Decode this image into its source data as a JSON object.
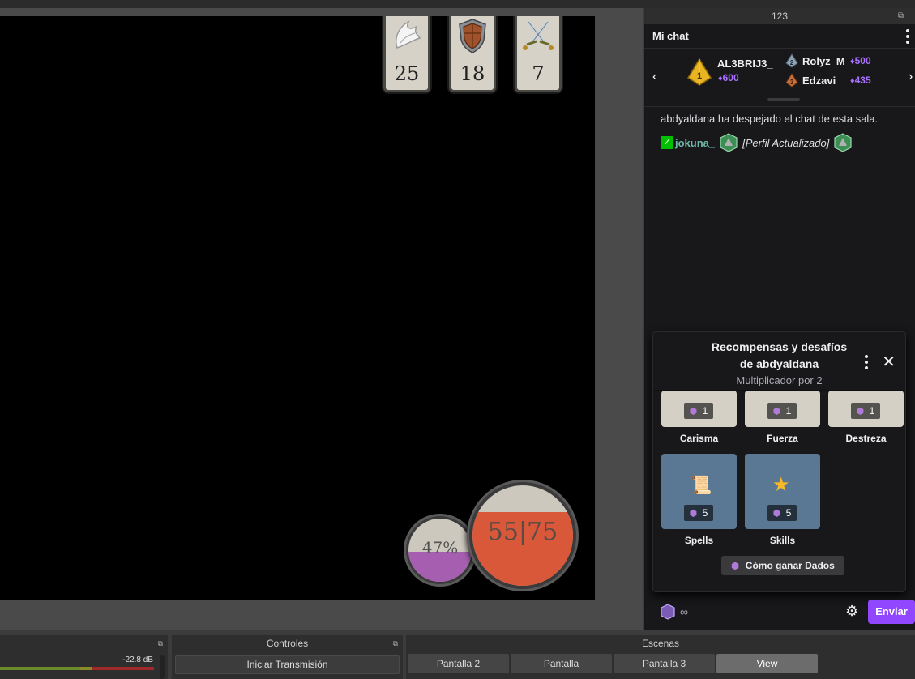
{
  "window": {
    "dock_title": "123"
  },
  "game": {
    "stats": [
      {
        "icon": "wing-icon",
        "value": "25"
      },
      {
        "icon": "shield-icon",
        "value": "18"
      },
      {
        "icon": "crossed-swords-icon",
        "value": "7"
      }
    ],
    "mana_orb": {
      "text": "47%",
      "fill": 0.47
    },
    "health_orb": {
      "text": "55|75",
      "current": 55,
      "max": 75
    }
  },
  "chat": {
    "title": "Mi chat",
    "leaderboard": {
      "first": {
        "rank": "1",
        "name": "AL3BRIJ3_",
        "points": "600"
      },
      "second": {
        "rank": "2",
        "name": "Rolyz_M",
        "points": "500"
      },
      "third": {
        "rank": "3",
        "name": "Edzavi",
        "points": "435"
      }
    },
    "messages": {
      "system": "abdyaldana ha despejado el chat de esta sala.",
      "user": "jokuna_",
      "text": "[Perfil Actualizado]"
    },
    "rewards": {
      "title_line1": "Recompensas y desafíos",
      "title_line2": "de abdyaldana",
      "subtitle": "Multiplicador por 2",
      "items": [
        {
          "label": "Carisma",
          "cost": "1"
        },
        {
          "label": "Fuerza",
          "cost": "1"
        },
        {
          "label": "Destreza",
          "cost": "1"
        },
        {
          "label": "Spells",
          "cost": "5"
        },
        {
          "label": "Skills",
          "cost": "5"
        }
      ],
      "how_button": "Cómo ganar Dados"
    },
    "footer": {
      "balance": "∞",
      "send": "Enviar"
    }
  },
  "docks": {
    "audio": {
      "level": "-22.8 dB"
    },
    "controls": {
      "title": "Controles",
      "start_stream": "Iniciar Transmisión"
    },
    "scenes": {
      "title": "Escenas",
      "items": [
        "Pantalla 2",
        "Pantalla",
        "Pantalla 3",
        "View"
      ],
      "active": "View"
    }
  },
  "colors": {
    "accent": "#9147ff",
    "health": "#d9583a",
    "mana": "#a65fb0"
  }
}
